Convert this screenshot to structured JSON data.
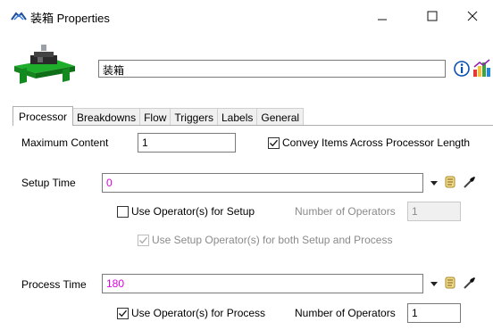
{
  "window": {
    "title": "装箱 Properties"
  },
  "header": {
    "object_name": "装箱"
  },
  "tabs": [
    {
      "label": "Processor",
      "active": true
    },
    {
      "label": "Breakdowns",
      "active": false
    },
    {
      "label": "Flow",
      "active": false
    },
    {
      "label": "Triggers",
      "active": false
    },
    {
      "label": "Labels",
      "active": false
    },
    {
      "label": "General",
      "active": false
    }
  ],
  "processor": {
    "max_content_label": "Maximum Content",
    "max_content_value": "1",
    "convey_label": "Convey Items Across Processor Length",
    "convey_checked": true,
    "setup_time_label": "Setup Time",
    "setup_time_value": "0",
    "use_operator_setup_label": "Use Operator(s) for Setup",
    "use_operator_setup_checked": false,
    "setup_num_operators_label": "Number of Operators",
    "setup_num_operators_value": "1",
    "use_setup_both_label": "Use Setup Operator(s) for both Setup and Process",
    "use_setup_both_checked": true,
    "process_time_label": "Process Time",
    "process_time_value": "180",
    "use_operator_process_label": "Use Operator(s) for Process",
    "use_operator_process_checked": true,
    "process_num_operators_label": "Number of Operators",
    "process_num_operators_value": "1"
  },
  "colors": {
    "code_text": "#e000e0",
    "info_icon": "#0a4fb0"
  },
  "icons": [
    "app-icon",
    "minimize-icon",
    "maximize-icon",
    "close-icon",
    "conveyor-object-icon",
    "info-icon",
    "color-chart-icon",
    "dropdown-arrow-icon",
    "script-scroll-icon",
    "eyedropper-icon",
    "checkmark-icon"
  ]
}
